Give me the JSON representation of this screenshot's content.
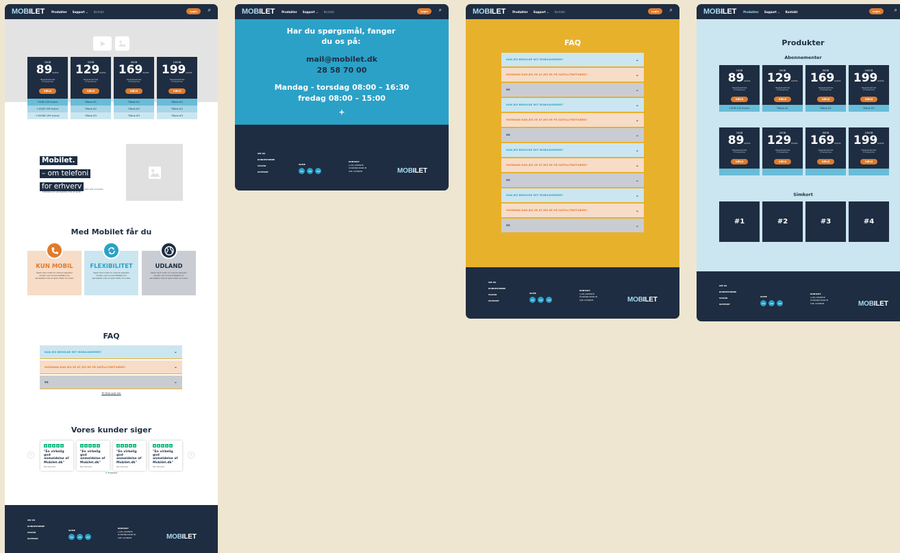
{
  "nav": {
    "logo": "MOBILET",
    "logo_prefix": "MOB",
    "logo_suffix": "ILET",
    "items": [
      "Produkter",
      "Support",
      "Kontakt"
    ],
    "login": "Login",
    "search_icon": "search-icon"
  },
  "home": {
    "plans": [
      {
        "gb": "10GB",
        "price": "89",
        "unit": "kr/md.",
        "desc1": "Ubegrænset tale",
        "desc2": "Fri sms/mms",
        "button": "VÆLG",
        "extra": [
          "+5GB 129 kr/md.",
          "+10GB 159 kr/md.",
          "+100GB 199 kr/md."
        ]
      },
      {
        "gb": "20GB",
        "price": "129",
        "unit": "kr/md.",
        "desc1": "Ubegrænset tale",
        "desc2": "Fri sms/mms",
        "button": "VÆLG",
        "extra": [
          "Tilbub #1",
          "Tilbub #2",
          "Tilbub #3"
        ]
      },
      {
        "gb": "50GB",
        "price": "169",
        "unit": "kr/md.",
        "desc1": "Ubegrænset tale",
        "desc2": "Fri sms/mms",
        "button": "VÆLG",
        "extra": [
          "Tilbub #1",
          "Tilbub #2",
          "Tilbub #3"
        ]
      },
      {
        "gb": "100GB",
        "price": "199",
        "unit": "kr/md.",
        "desc1": "Ubegrænset tale",
        "desc2": "Fri sms/mms",
        "button": "VÆLG",
        "extra": [
          "Tilbub #1",
          "Tilbub #2",
          "Tilbub #3"
        ]
      }
    ],
    "about_title": [
      "Mobilet.",
      "– om telefoni",
      "for erhverv"
    ],
    "about_text": "Sjeed mint modic to mollore sequatur remam ent occuems totitlaborum vendebitiis mile et quist.",
    "features_title": "Med Mobilet får du",
    "features": [
      {
        "title": "KUN MOBIL",
        "icon": "phone-icon",
        "text": "Sjeed mint modic to mollore sequatur remam ent occues totitlaborum vendebitiis mile et quist. Mollo to mollor.",
        "color": "#e07b2c",
        "bg": "#f7dcc7"
      },
      {
        "title": "FLEXIBILITET",
        "icon": "refresh-icon",
        "text": "Sjeed mint modic to mollore sequatur remam ent occues totitlaborum vendebitiis mile et quist. Mollo to mollor.",
        "color": "#2ba1c7",
        "bg": "#cbe6f0"
      },
      {
        "title": "UDLAND",
        "icon": "globe-icon",
        "text": "Sjeed mint modic to mollore sequatur remam ent occues totitlaborum vendebitiis mile et quist. Mollo to mollor.",
        "color": "#1e2d42",
        "bg": "#c9cdd3"
      }
    ],
    "faq_title": "FAQ",
    "faq": [
      "KAN JEG BEHOLDE MIT MOBILNUMMER?",
      "HVORDAN KAN JEG SE AT JEG ER PÅ SATELLITNETVÆRK?",
      "5G"
    ],
    "faq_link": "Til flere svar her",
    "reviews_title": "Vores kunder siger",
    "review_text": "\"En virkelig god anmeldelse af Mobilet.dk\"",
    "review_author": "Navn Navnesen",
    "trustpilot": "Trustpilot"
  },
  "contact": {
    "title": "Har du spørgsmål, fanger du os på:",
    "email": "mail@mobilet.dk",
    "phone": "28 58 70 00",
    "hours1": "Mandag - torsdag 08:00 – 16:30",
    "hours2": "fredag 08:00 – 15:00",
    "plus": "+"
  },
  "faqpage": {
    "title": "FAQ",
    "items": [
      "KAN JEG BEHOLDE MIT MOBILNUMMER?",
      "HVORDAN KAN JEG SE AT JEG ER PÅ SATELLITNETVÆRK?",
      "5G",
      "KAN JEG BEHOLDE MIT MOBILNUMMER?",
      "HVORDAN KAN JEG SE AT JEG ER PÅ SATELLITNETVÆRK?",
      "5G",
      "KAN JEG BEHOLDE MIT MOBILNUMMER?",
      "HVORDAN KAN JEG SE AT JEG ER PÅ SATELLITNETVÆRK?",
      "5G",
      "KAN JEG BEHOLDE MIT MOBILNUMMER?",
      "HVORDAN KAN JEG SE AT JEG ER PÅ SATELLITNETVÆRK?",
      "5G"
    ]
  },
  "products": {
    "title": "Produkter",
    "subs_title": "Abonnementer",
    "sim_title": "Simkort",
    "sims": [
      "#1",
      "#2",
      "#3",
      "#4"
    ]
  },
  "footer": {
    "links": [
      "OM OS",
      "KUNDESTØRRE",
      "VILKÅR",
      "SUPPORT"
    ],
    "social_title": "SOME",
    "social": [
      "#1",
      "#2",
      "#3"
    ],
    "contact_title": "KONTAKT",
    "contact_lines": [
      "(+45) 12345678",
      "kontakt@mobilet.dk",
      "CVR: 12345678"
    ]
  },
  "colors": {
    "navy": "#1e2d42",
    "blue": "#2ba1c7",
    "orange": "#e07b2c",
    "yellow": "#e8b12c",
    "lightblue": "#cbe6f0",
    "beige": "#efe6d1"
  }
}
